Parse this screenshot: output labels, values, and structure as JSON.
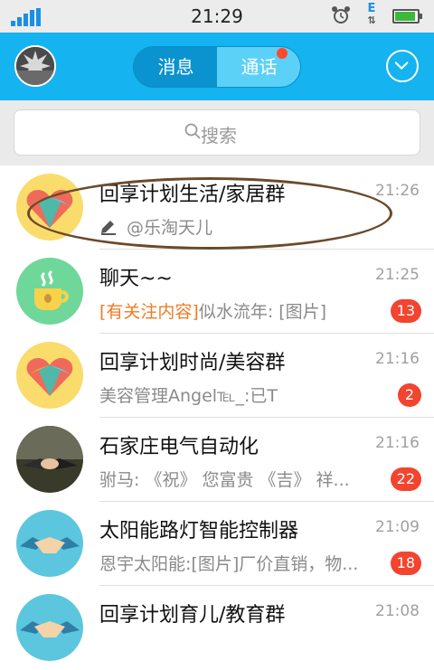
{
  "status_bar": {
    "time": "21:29",
    "network_label": "E"
  },
  "header": {
    "tabs": [
      {
        "label": "消息"
      },
      {
        "label": "通话"
      }
    ]
  },
  "search": {
    "placeholder": "搜索"
  },
  "conversations": [
    {
      "name": "回享计划生活/家居群",
      "time": "21:26",
      "preview": "@乐淘天儿",
      "badge": ""
    },
    {
      "name": "聊天~~",
      "time": "21:25",
      "tag": "[有关注内容]",
      "preview": "似水流年: [图片]",
      "badge": "13"
    },
    {
      "name": "回享计划时尚/美容群",
      "time": "21:16",
      "preview": "美容管理Angel℡_:已T",
      "badge": "2"
    },
    {
      "name": "石家庄电气自动化",
      "time": "21:16",
      "preview": "驸马: 《祝》 您富贵 《吉》 祥...",
      "badge": "22"
    },
    {
      "name": "太阳能路灯智能控制器",
      "time": "21:09",
      "preview": "恩宇太阳能:[图片]厂价直销，物...",
      "badge": "18"
    },
    {
      "name": "回享计划育儿/教育群",
      "time": "21:08",
      "preview": "",
      "badge": ""
    }
  ],
  "colors": {
    "accent": "#15b3ef",
    "badge": "#f2442e",
    "tag": "#f07b22"
  }
}
